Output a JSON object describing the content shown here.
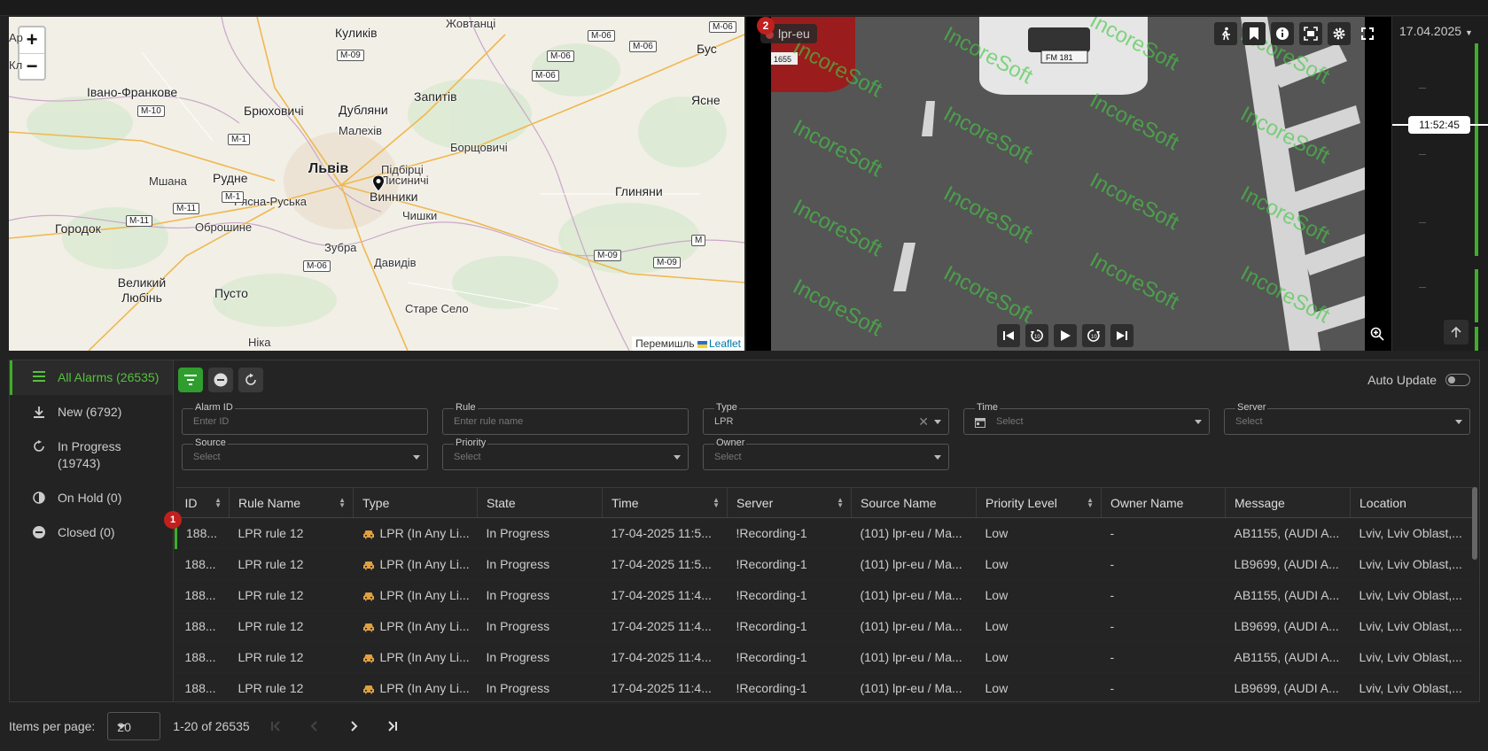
{
  "map": {
    "zoom_in": "+",
    "zoom_out": "−",
    "labels": [
      {
        "t": "Жовтанці",
        "cls": ""
      },
      {
        "t": "Куликів",
        "cls": "big"
      },
      {
        "t": "Івано-Франкове",
        "cls": "big"
      },
      {
        "t": "Дубляни",
        "cls": "big"
      },
      {
        "t": "Запитів",
        "cls": "big"
      },
      {
        "t": "Малехів",
        "cls": ""
      },
      {
        "t": "Брюховичі",
        "cls": "big"
      },
      {
        "t": "Борщовичі",
        "cls": ""
      },
      {
        "t": "Львів",
        "cls": "city"
      },
      {
        "t": "Підбірці",
        "cls": ""
      },
      {
        "t": "Лисиничі",
        "cls": ""
      },
      {
        "t": "Винники",
        "cls": "big"
      },
      {
        "t": "Мшана",
        "cls": ""
      },
      {
        "t": "Рудне",
        "cls": "big"
      },
      {
        "t": "Рясна-Руська",
        "cls": ""
      },
      {
        "t": "Оброшине",
        "cls": ""
      },
      {
        "t": "Чишки",
        "cls": ""
      },
      {
        "t": "Глиняни",
        "cls": "big"
      },
      {
        "t": "Городок",
        "cls": "big"
      },
      {
        "t": "Зубра",
        "cls": ""
      },
      {
        "t": "Давидів",
        "cls": ""
      },
      {
        "t": "Великий Любінь",
        "cls": "big"
      },
      {
        "t": "Пусто",
        "cls": "big"
      },
      {
        "t": "Старе Село",
        "cls": ""
      },
      {
        "t": "Бус",
        "cls": "big"
      },
      {
        "t": "Ясне",
        "cls": "big"
      },
      {
        "t": "Ар",
        "cls": ""
      },
      {
        "t": "Кл",
        "cls": ""
      },
      {
        "t": "Ніка",
        "cls": ""
      }
    ],
    "roads": [
      "M-06",
      "M-06",
      "M-09",
      "M-06",
      "M-06",
      "M-10",
      "M-1",
      "M-11",
      "M-1",
      "M-11",
      "M-06",
      "M-09",
      "M-09",
      "M"
    ],
    "attribution_prefix": "Перемишль",
    "attribution_link": "Leaflet"
  },
  "video": {
    "camera": "lpr-eu",
    "badge": "2",
    "watermark": "IncoreSoft",
    "plate_left": "1655",
    "plate_center": "FM 181"
  },
  "timeline": {
    "date": "17.04.2025",
    "time": "11:52:45"
  },
  "sidebar": {
    "items": [
      {
        "label": "All Alarms (26535)",
        "icon": "list-icon"
      },
      {
        "label": "New (6792)",
        "icon": "download-icon"
      },
      {
        "label": "In Progress (19743)",
        "icon": "refresh-icon"
      },
      {
        "label": "On Hold (0)",
        "icon": "pause-icon"
      },
      {
        "label": "Closed (0)",
        "icon": "minus-circle-icon"
      }
    ]
  },
  "toolbar": {
    "auto_update": "Auto Update"
  },
  "filters": {
    "alarm_id": {
      "label": "Alarm ID",
      "placeholder": "Enter ID"
    },
    "rule": {
      "label": "Rule",
      "placeholder": "Enter rule name"
    },
    "type": {
      "label": "Type",
      "value": "LPR"
    },
    "time": {
      "label": "Time",
      "placeholder": "Select"
    },
    "server": {
      "label": "Server",
      "placeholder": "Select"
    },
    "source": {
      "label": "Source",
      "placeholder": "Select"
    },
    "priority": {
      "label": "Priority",
      "placeholder": "Select"
    },
    "owner": {
      "label": "Owner",
      "placeholder": "Select"
    }
  },
  "table": {
    "columns": [
      "ID",
      "Rule Name",
      "Type",
      "State",
      "Time",
      "Server",
      "Source Name",
      "Priority Level",
      "Owner Name",
      "Message",
      "Location"
    ],
    "row_badge": "1",
    "rows": [
      [
        "188...",
        "LPR rule 12",
        "LPR (In Any Li...",
        "In Progress",
        "17-04-2025 11:5...",
        "!Recording-1",
        "(101) lpr-eu / Ma...",
        "Low",
        "-",
        "AB1155, (AUDI A...",
        "Lviv, Lviv Oblast,..."
      ],
      [
        "188...",
        "LPR rule 12",
        "LPR (In Any Li...",
        "In Progress",
        "17-04-2025 11:5...",
        "!Recording-1",
        "(101) lpr-eu / Ma...",
        "Low",
        "-",
        "LB9699, (AUDI A...",
        "Lviv, Lviv Oblast,..."
      ],
      [
        "188...",
        "LPR rule 12",
        "LPR (In Any Li...",
        "In Progress",
        "17-04-2025 11:4...",
        "!Recording-1",
        "(101) lpr-eu / Ma...",
        "Low",
        "-",
        "AB1155, (AUDI A...",
        "Lviv, Lviv Oblast,..."
      ],
      [
        "188...",
        "LPR rule 12",
        "LPR (In Any Li...",
        "In Progress",
        "17-04-2025 11:4...",
        "!Recording-1",
        "(101) lpr-eu / Ma...",
        "Low",
        "-",
        "LB9699, (AUDI A...",
        "Lviv, Lviv Oblast,..."
      ],
      [
        "188...",
        "LPR rule 12",
        "LPR (In Any Li...",
        "In Progress",
        "17-04-2025 11:4...",
        "!Recording-1",
        "(101) lpr-eu / Ma...",
        "Low",
        "-",
        "AB1155, (AUDI A...",
        "Lviv, Lviv Oblast,..."
      ],
      [
        "188...",
        "LPR rule 12",
        "LPR (In Any Li...",
        "In Progress",
        "17-04-2025 11:4...",
        "!Recording-1",
        "(101) lpr-eu / Ma...",
        "Low",
        "-",
        "LB9699, (AUDI A...",
        "Lviv, Lviv Oblast,..."
      ]
    ]
  },
  "pager": {
    "items_per_page_label": "Items per page:",
    "per_page": "20",
    "range": "1-20 of 26535"
  },
  "colors": {
    "accent": "#3fae2a",
    "badge": "#c0201e"
  }
}
